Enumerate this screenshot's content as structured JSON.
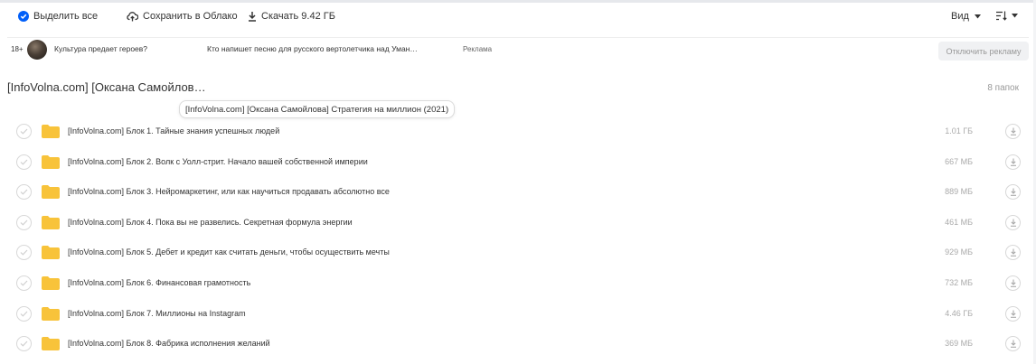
{
  "toolbar": {
    "select_all": "Выделить все",
    "save_cloud": "Сохранить в Облако",
    "download": "Скачать 9.42 ГБ",
    "view": "Вид",
    "colors": {
      "accent": "#005ff9",
      "icon": "#333333"
    }
  },
  "ad": {
    "age": "18+",
    "text1": "Культура предает героев?",
    "text2": "Кто напишет песню для русского вертолетчика над Уман…",
    "label": "Реклама",
    "disable_button": "Отключить рекламу"
  },
  "folder": {
    "title": "[InfoVolna.com] [Оксана Самойлов…",
    "count": "8 папок",
    "tooltip": "[InfoVolna.com] [Оксана Самойлова] Стратегия на миллион (2021)"
  },
  "items": [
    {
      "name": "[InfoVolna.com] Блок 1. Тайные знания успешных людей",
      "size": "1.01 ГБ"
    },
    {
      "name": "[InfoVolna.com] Блок 2. Волк с Уолл-стрит. Начало вашей собственной империи",
      "size": "667 МБ"
    },
    {
      "name": "[InfoVolna.com] Блок 3. Нейромаркетинг, или как научиться продавать абсолютно все",
      "size": "889 МБ"
    },
    {
      "name": "[InfoVolna.com] Блок 4. Пока вы не развелись. Секретная формула энергии",
      "size": "461 МБ"
    },
    {
      "name": "[InfoVolna.com] Блок 5. Дебет и кредит как считать деньги, чтобы осуществить мечты",
      "size": "929 МБ"
    },
    {
      "name": "[InfoVolna.com] Блок 6. Финансовая грамотность",
      "size": "732 МБ"
    },
    {
      "name": "[InfoVolna.com] Блок 7. Миллионы на Instagram",
      "size": "4.46 ГБ"
    },
    {
      "name": "[InfoVolna.com] Блок 8. Фабрика исполнения желаний",
      "size": "369 МБ"
    }
  ],
  "icons": {
    "folder_color": "#f8c33a",
    "select_icon": "check-circle-icon",
    "cloud_icon": "cloud-upload-icon",
    "download_icon": "download-icon",
    "sort_icon": "sort-icon"
  }
}
